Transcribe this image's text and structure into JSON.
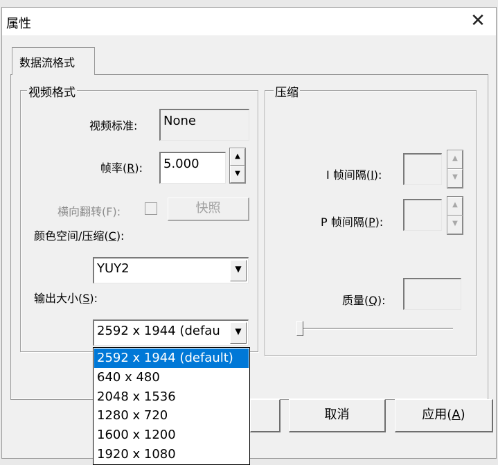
{
  "window": {
    "title": "属性",
    "close_glyph": "✕"
  },
  "tabs": [
    {
      "label": "数据流格式"
    }
  ],
  "video_group": {
    "legend": "视频格式",
    "standard_label": "视频标准:",
    "standard_value": "None",
    "framerate_label_pre": "帧率(",
    "framerate_label_key": "R",
    "framerate_label_post": "):",
    "framerate_value": "5.000",
    "flip_label": "横向翻转(F):",
    "snapshot_label": "快照",
    "colorspace_label_pre": "颜色空间/压缩(",
    "colorspace_label_key": "C",
    "colorspace_label_post": "):",
    "colorspace_value": "YUY2",
    "output_label_pre": "输出大小(",
    "output_label_key": "S",
    "output_label_post": "):",
    "output_value": "2592 x 1944  (defau"
  },
  "compression_group": {
    "legend": "压缩",
    "iframe_label_pre": "I 帧间隔(",
    "iframe_label_key": "I",
    "iframe_label_post": "):",
    "pframe_label_pre": "P 帧间隔(",
    "pframe_label_key": "P",
    "pframe_label_post": "):",
    "quality_label_pre": "质量(",
    "quality_label_key": "Q",
    "quality_label_post": "):",
    "quality_slider_level": 0
  },
  "output_dropdown": {
    "options": [
      "2592 x 1944  (default)",
      "640 x 480",
      "2048 x 1536",
      "1280 x 720",
      "1600 x 1200",
      "1920 x 1080"
    ],
    "selected_index": 0
  },
  "footer": {
    "cancel_label": "取消",
    "apply_label_pre": "应用(",
    "apply_label_key": "A",
    "apply_label_post": ")"
  }
}
